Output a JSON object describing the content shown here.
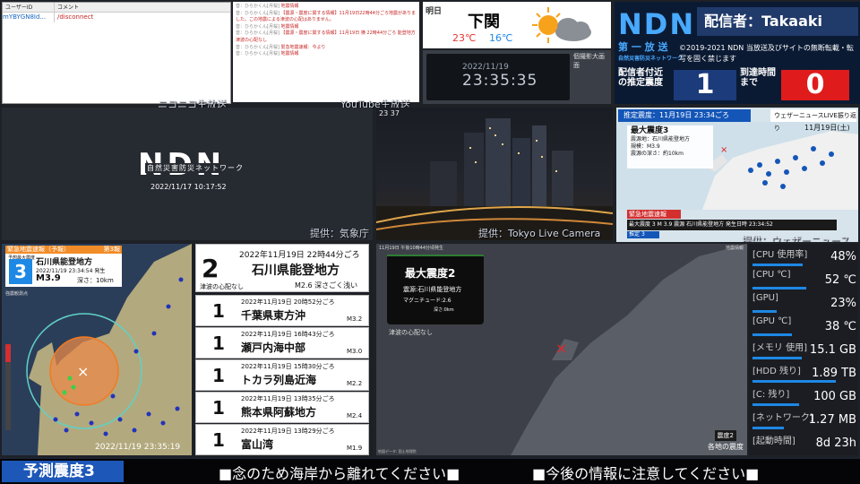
{
  "comments": {
    "header_user": "ユーザーID",
    "header_comment": "コメント",
    "rows": [
      {
        "user": "mYBYGN8Id...",
        "comment": "/disconnect"
      }
    ],
    "source": "ニコニコ生放送"
  },
  "youtube": {
    "source": "YouTube生放送",
    "messages": [
      {
        "name": "音：ひらかくん[月桜]",
        "text": "地震情報"
      },
      {
        "name": "音：ひらかくん[月桜]",
        "text": "【震源・震度に関する情報】11月19日22時44分ごろ地震がありました。この地震による津波の心配はありません。"
      },
      {
        "name": "音：ひらかくん[月桜]",
        "text": "地震情報"
      },
      {
        "name": "音：ひらかくん[月桜]",
        "text": "【震源・震度に関する情報】11月19日 横 22時44分ごろ 能登地方 津波の心配なし"
      },
      {
        "name": "音：ひらかくん[月桜]",
        "text": "緊急地震速報：今より"
      },
      {
        "name": "音：ひらかくん[月桜]",
        "text": "地震情報"
      }
    ]
  },
  "weather": {
    "tag": "明日",
    "city": "下関",
    "high": "23℃",
    "low": "16℃"
  },
  "clock": {
    "date": "2022/11/19",
    "time": "23:35:35",
    "camera": "個撮影大画面"
  },
  "header": {
    "logo": "NDN",
    "broadcaster": "配信者：Takaaki",
    "subtitle": "第 一 放 送",
    "sub2": "自然災害防災ネットワーク",
    "copyright": "©2019-2021 NDN 当放送及びサイトの無断転載・転写を固く禁じます",
    "kind_label": "配信者付近の推定震度",
    "kind_value": "1",
    "arrival_label": "到達時間まで",
    "arrival_value": "0"
  },
  "ndn_video": {
    "logo": "NDN",
    "caption": "自然災害防災ネットワーク",
    "timestamp": "2022/11/17 10:17:52",
    "source": "提供：気象庁"
  },
  "city_cam": {
    "time": "23 37",
    "source": "提供：Tokyo Live Camera"
  },
  "weathernews": {
    "estimate": "推定震度：11月19日 23:34ごろ",
    "live": "ウェザーニュースLIVE振り返り",
    "date": "11月19日(土)",
    "info_title": "最大震度3",
    "info_lines": [
      "震源地：石川県能登地方",
      "規模：M3.9",
      "震源の深さ：約10km"
    ],
    "eew_label": "緊急地震速報",
    "eew_bar": "最大震度 3  M 3.9  震源 石川県能登地方  発生日時 23:34:52",
    "pred_label": "推定",
    "pred_value": "3",
    "source": "提供：ウェザーニュース"
  },
  "eew": {
    "title": "緊急地震速報（予報）",
    "report": "第3報",
    "intensity_label": "予想最大震度",
    "intensity": "3",
    "region": "石川県能登地方",
    "time": "2022/11/19 23:34:54 発生",
    "magnitude": "M3.9",
    "depth": "深さ：10km",
    "obs_label": "強震観測点",
    "timestamp": "2022/11/19 23:35:19"
  },
  "history": {
    "latest": {
      "intensity": "2",
      "time": "2022年11月19日 22時44分ごろ",
      "region": "石川県能登地方",
      "tsunami": "津波の心配なし",
      "mag": "M2.6 深さごく浅い"
    },
    "items": [
      {
        "intensity": "1",
        "time": "2022年11月19日 20時52分ごろ",
        "region": "千葉県東方沖",
        "mag": "M3.2"
      },
      {
        "intensity": "1",
        "time": "2022年11月19日 16時43分ごろ",
        "region": "瀬戸内海中部",
        "mag": "M3.0"
      },
      {
        "intensity": "1",
        "time": "2022年11月19日 15時30分ごろ",
        "region": "トカラ列島近海",
        "mag": "M2.2"
      },
      {
        "intensity": "1",
        "time": "2022年11月19日 13時35分ごろ",
        "region": "熊本県阿蘇地方",
        "mag": "M2.4"
      },
      {
        "intensity": "1",
        "time": "2022年11月19日 13時29分ごろ",
        "region": "富山湾",
        "mag": "M1.9"
      }
    ]
  },
  "center_map": {
    "header": "11月19日 午後10時44分頃発生",
    "header_right": "地震情報",
    "card_title": "最大震度2",
    "card_line1": "震源:石川県能登地方",
    "card_line2": "マグニチュード:2.6",
    "card_line3": "深さ:0km",
    "tsunami": "津波の心配なし",
    "attribution": "地図データ: 国土地理院",
    "badge": "震度2",
    "badge2": "各地の震度"
  },
  "stats": [
    {
      "key": "[CPU 使用率]",
      "value": "48%",
      "fill": 0.48
    },
    {
      "key": "[CPU ℃]",
      "value": "52 ℃",
      "fill": 0.52
    },
    {
      "key": "[GPU]",
      "value": "23%",
      "fill": 0.23
    },
    {
      "key": "[GPU ℃]",
      "value": "38 ℃",
      "fill": 0.38
    },
    {
      "key": "[メモリ 使用]",
      "value": "15.1 GB",
      "fill": 0.47
    },
    {
      "key": "[HDD 残り]",
      "value": "1.89 TB",
      "fill": 0.8
    },
    {
      "key": "[C: 残り]",
      "value": "100 GB",
      "fill": 0.45
    },
    {
      "key": "[ネットワーク]",
      "value": "1.27 MB",
      "fill": 0.3
    },
    {
      "key": "[起動時間]",
      "value": "8d 23h",
      "fill": 0
    }
  ],
  "ticker": {
    "tag": "予測震度3",
    "msg1": "■念のため海岸から離れてください■",
    "msg2": "■今後の情報に注意してください■"
  },
  "colors": {
    "accent": "#1d57b8",
    "alert": "#e01b1b",
    "eew": "#f28c28"
  }
}
